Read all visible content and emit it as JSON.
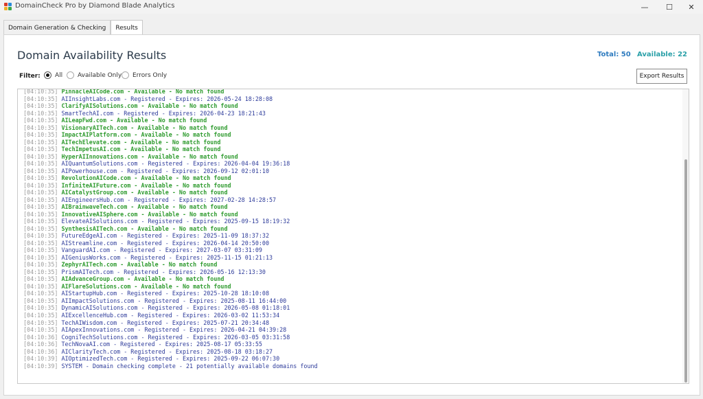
{
  "window": {
    "title": "DomainCheck Pro by Diamond Blade Analytics",
    "minimize_icon": "minimize-icon",
    "maximize_icon": "maximize-icon",
    "close_icon": "close-icon",
    "min_glyph": "—",
    "max_glyph": "☐",
    "close_glyph": "✕"
  },
  "tabs": [
    {
      "label": "Domain Generation & Checking",
      "active": false
    },
    {
      "label": "Results",
      "active": true
    }
  ],
  "header": {
    "title": "Domain Availability Results",
    "total_label": "Total: 50",
    "available_label": "Available: 22",
    "total_color": "#2e7bbf",
    "available_color": "#2aa0a8"
  },
  "filter": {
    "label": "Filter:",
    "options": [
      {
        "label": "All",
        "checked": true
      },
      {
        "label": "Available Only",
        "checked": false
      },
      {
        "label": "Errors Only",
        "checked": false
      }
    ]
  },
  "export_button": "Export Results",
  "log": [
    {
      "ts": "[04:10:35]",
      "msg": "PinnacleAICode.com - Available - No match found",
      "kind": "available"
    },
    {
      "ts": "[04:10:35]",
      "msg": "AIInsightLabs.com - Registered - Expires: 2026-05-24 18:28:08",
      "kind": "registered"
    },
    {
      "ts": "[04:10:35]",
      "msg": "ClarifyAISolutions.com - Available - No match found",
      "kind": "available"
    },
    {
      "ts": "[04:10:35]",
      "msg": "SmartTechAI.com - Registered - Expires: 2026-04-23 18:21:43",
      "kind": "registered"
    },
    {
      "ts": "[04:10:35]",
      "msg": "AILeapFwd.com - Available - No match found",
      "kind": "available"
    },
    {
      "ts": "[04:10:35]",
      "msg": "VisionaryAITech.com - Available - No match found",
      "kind": "available"
    },
    {
      "ts": "[04:10:35]",
      "msg": "ImpactAIPlatform.com - Available - No match found",
      "kind": "available"
    },
    {
      "ts": "[04:10:35]",
      "msg": "AITechElevate.com - Available - No match found",
      "kind": "available"
    },
    {
      "ts": "[04:10:35]",
      "msg": "TechImpetusAI.com - Available - No match found",
      "kind": "available"
    },
    {
      "ts": "[04:10:35]",
      "msg": "HyperAIInnovations.com - Available - No match found",
      "kind": "available"
    },
    {
      "ts": "[04:10:35]",
      "msg": "AIQuantumSolutions.com - Registered - Expires: 2026-04-04 19:36:18",
      "kind": "registered"
    },
    {
      "ts": "[04:10:35]",
      "msg": "AIPowerhouse.com - Registered - Expires: 2026-09-12 02:01:10",
      "kind": "registered"
    },
    {
      "ts": "[04:10:35]",
      "msg": "RevolutionAICode.com - Available - No match found",
      "kind": "available"
    },
    {
      "ts": "[04:10:35]",
      "msg": "InfiniteAIFuture.com - Available - No match found",
      "kind": "available"
    },
    {
      "ts": "[04:10:35]",
      "msg": "AICatalystGroup.com - Available - No match found",
      "kind": "available"
    },
    {
      "ts": "[04:10:35]",
      "msg": "AIEngineersHub.com - Registered - Expires: 2027-02-28 14:28:57",
      "kind": "registered"
    },
    {
      "ts": "[04:10:35]",
      "msg": "AIBrainwaveTech.com - Available - No match found",
      "kind": "available"
    },
    {
      "ts": "[04:10:35]",
      "msg": "InnovativeAISphere.com - Available - No match found",
      "kind": "available"
    },
    {
      "ts": "[04:10:35]",
      "msg": "ElevateAISolutions.com - Registered - Expires: 2025-09-15 18:19:32",
      "kind": "registered"
    },
    {
      "ts": "[04:10:35]",
      "msg": "SynthesisAITech.com - Available - No match found",
      "kind": "available"
    },
    {
      "ts": "[04:10:35]",
      "msg": "FutureEdgeAI.com - Registered - Expires: 2025-11-09 18:37:32",
      "kind": "registered"
    },
    {
      "ts": "[04:10:35]",
      "msg": "AIStreamline.com - Registered - Expires: 2026-04-14 20:50:00",
      "kind": "registered"
    },
    {
      "ts": "[04:10:35]",
      "msg": "VanguardAI.com - Registered - Expires: 2027-03-07 03:31:09",
      "kind": "registered"
    },
    {
      "ts": "[04:10:35]",
      "msg": "AIGeniusWorks.com - Registered - Expires: 2025-11-15 01:21:13",
      "kind": "registered"
    },
    {
      "ts": "[04:10:35]",
      "msg": "ZephyrAITech.com - Available - No match found",
      "kind": "available"
    },
    {
      "ts": "[04:10:35]",
      "msg": "PrismAITech.com - Registered - Expires: 2026-05-16 12:13:30",
      "kind": "registered"
    },
    {
      "ts": "[04:10:35]",
      "msg": "AIAdvanceGroup.com - Available - No match found",
      "kind": "available"
    },
    {
      "ts": "[04:10:35]",
      "msg": "AIFlareSolutions.com - Available - No match found",
      "kind": "available"
    },
    {
      "ts": "[04:10:35]",
      "msg": "AIStartupHub.com - Registered - Expires: 2025-10-28 18:10:08",
      "kind": "registered"
    },
    {
      "ts": "[04:10:35]",
      "msg": "AIImpactSolutions.com - Registered - Expires: 2025-08-11 16:44:00",
      "kind": "registered"
    },
    {
      "ts": "[04:10:35]",
      "msg": "DynamicAISolutions.com - Registered - Expires: 2026-05-08 01:18:01",
      "kind": "registered"
    },
    {
      "ts": "[04:10:35]",
      "msg": "AIExcellenceHub.com - Registered - Expires: 2026-03-02 11:53:34",
      "kind": "registered"
    },
    {
      "ts": "[04:10:35]",
      "msg": "TechAIWisdom.com - Registered - Expires: 2025-07-21 20:34:48",
      "kind": "registered"
    },
    {
      "ts": "[04:10:35]",
      "msg": "AIApexInnovations.com - Registered - Expires: 2026-04-21 04:39:28",
      "kind": "registered"
    },
    {
      "ts": "[04:10:36]",
      "msg": "CogniTechSolutions.com - Registered - Expires: 2026-03-05 03:31:58",
      "kind": "registered"
    },
    {
      "ts": "[04:10:36]",
      "msg": "TechNovaAI.com - Registered - Expires: 2025-08-17 05:33:55",
      "kind": "registered"
    },
    {
      "ts": "[04:10:36]",
      "msg": "AIClarityTech.com - Registered - Expires: 2025-08-18 03:18:27",
      "kind": "registered"
    },
    {
      "ts": "[04:10:39]",
      "msg": "AIOptimizedTech.com - Registered - Expires: 2025-09-22 06:07:30",
      "kind": "registered"
    },
    {
      "ts": "[04:10:39]",
      "msg": "SYSTEM - Domain checking complete - 21 potentially available domains found",
      "kind": "system"
    }
  ]
}
